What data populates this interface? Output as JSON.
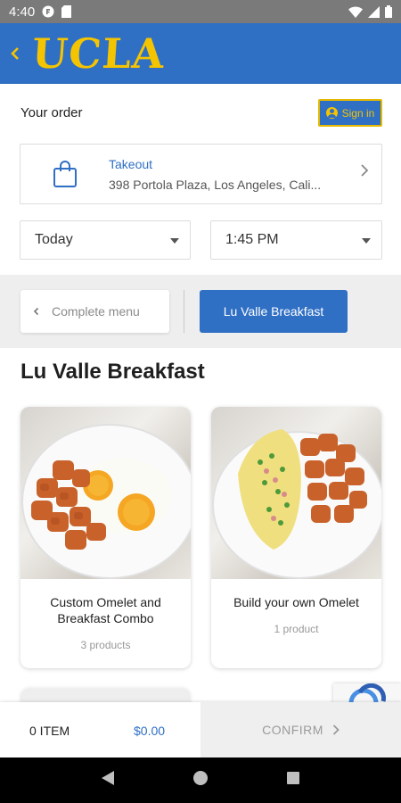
{
  "status_bar": {
    "time": "4:40"
  },
  "header": {
    "back_icon": "chevron-left-icon",
    "brand": "UCLA",
    "accent_color": "#f5c400",
    "bar_color": "#2f6fc4"
  },
  "order": {
    "title": "Your order",
    "signin_label": "Sign in",
    "takeout": {
      "title": "Takeout",
      "address": "398 Portola Plaza, Los Angeles, Cali..."
    },
    "day_value": "Today",
    "time_value": "1:45 PM"
  },
  "menu_nav": {
    "complete_menu_label": "Complete menu",
    "active_tab_label": "Lu Valle Breakfast"
  },
  "section": {
    "title": "Lu Valle Breakfast"
  },
  "products": [
    {
      "name": "Custom Omelet and Breakfast Combo",
      "count": "3 products"
    },
    {
      "name": "Build your own Omelet",
      "count": "1 product"
    }
  ],
  "cart": {
    "items": "0 ITEM",
    "total": "$0.00",
    "confirm_label": "CONFIRM"
  }
}
